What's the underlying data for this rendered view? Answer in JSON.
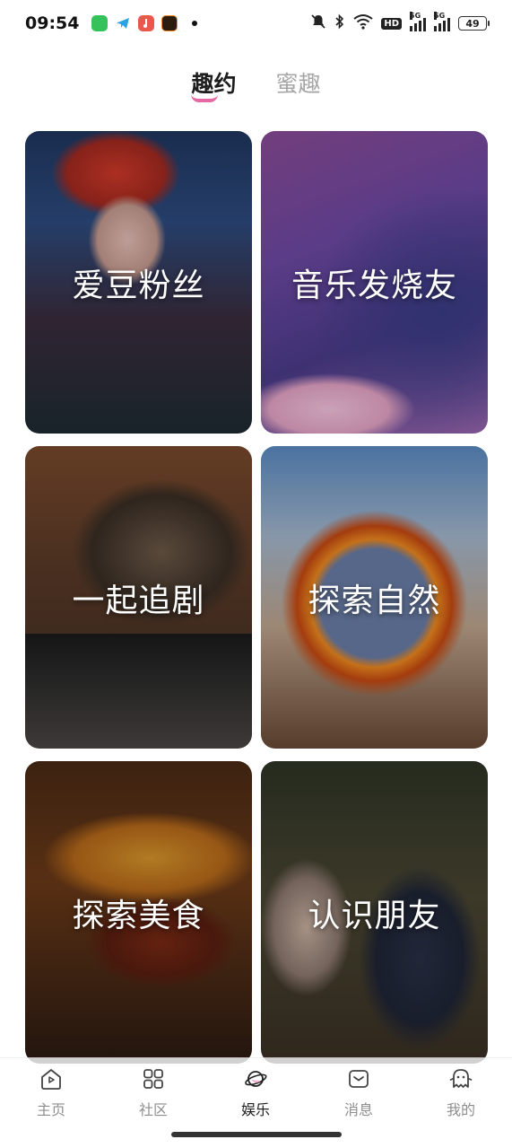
{
  "status_bar": {
    "time": "09:54",
    "notification_icons": [
      "messages-app-icon",
      "telegram-icon",
      "music-app-icon",
      "game-app-icon"
    ],
    "right_icons": [
      "mute-icon",
      "bluetooth-icon",
      "wifi-icon",
      "hd-icon",
      "signal-5g-icon",
      "signal-5g-icon"
    ],
    "hd_label": "HD",
    "network_label": "5G",
    "battery": "49"
  },
  "top_tabs": [
    {
      "label": "趣约",
      "active": true
    },
    {
      "label": "蜜趣",
      "active": false
    }
  ],
  "cards": [
    {
      "label": "爱豆粉丝"
    },
    {
      "label": "音乐发烧友"
    },
    {
      "label": "一起追剧"
    },
    {
      "label": "探索自然"
    },
    {
      "label": "探索美食"
    },
    {
      "label": "认识朋友"
    }
  ],
  "bottom_nav": [
    {
      "label": "主页",
      "icon": "home-icon",
      "active": false
    },
    {
      "label": "社区",
      "icon": "grid-icon",
      "active": false
    },
    {
      "label": "娱乐",
      "icon": "planet-icon",
      "active": true
    },
    {
      "label": "消息",
      "icon": "message-icon",
      "active": false
    },
    {
      "label": "我的",
      "icon": "ghost-icon",
      "active": false
    }
  ],
  "colors": {
    "accent_underline": "#e36aa4",
    "inactive_text": "#8e8e8e",
    "active_text": "#222222"
  }
}
